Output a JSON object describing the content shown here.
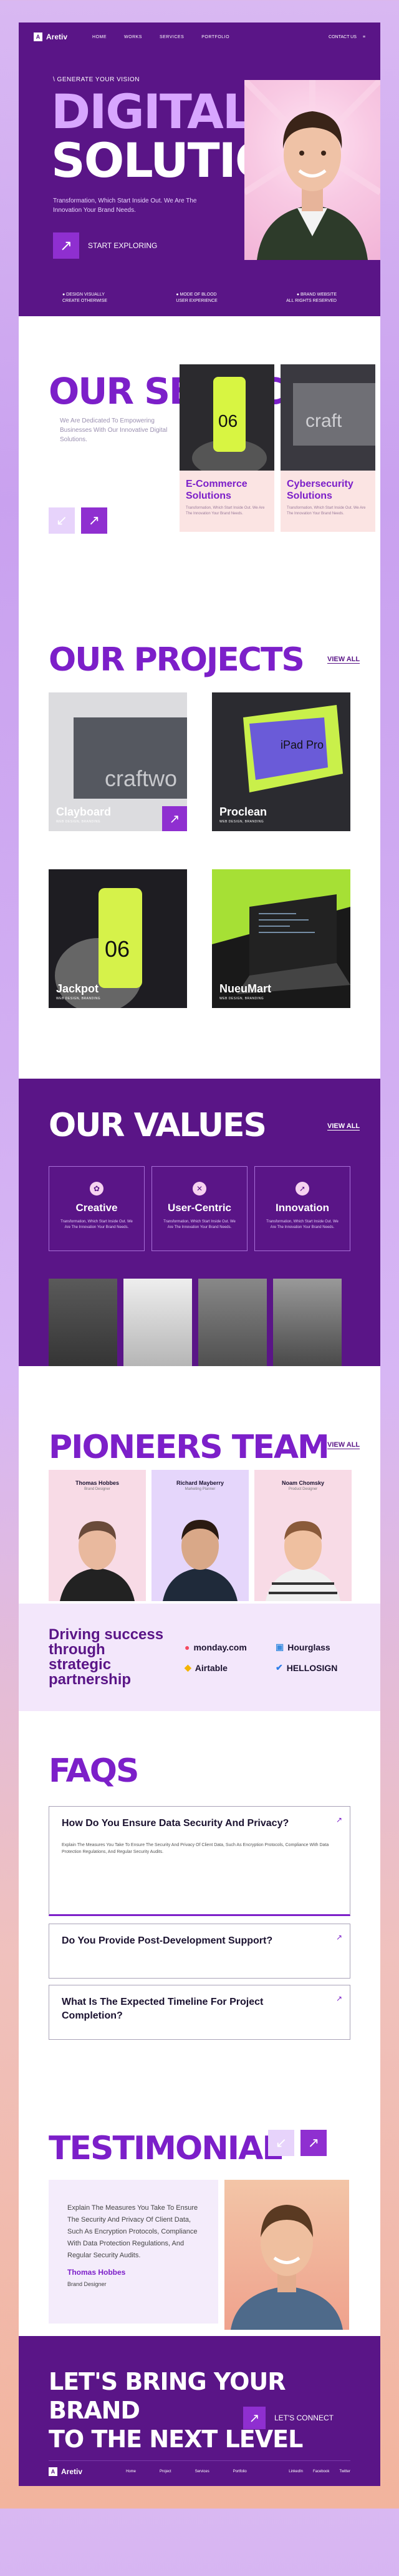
{
  "nav": {
    "brand": "Aretiv",
    "links": [
      "HOME",
      "WORKS",
      "SERVICES",
      "PORTFOLIO"
    ],
    "contact": "CONTACT US"
  },
  "hero": {
    "eyebrow": "\\ GENERATE YOUR VISION",
    "title_l1": "DIGITAL",
    "title_l2": "SOLUTIONS",
    "subtitle": "Transformation, Which Start Inside Out. We Are The Innovation Your Brand Needs.",
    "cta": "START EXPLORING",
    "foot_left": [
      "● DESIGN VISUALLY",
      "CREATE OTHERWISE"
    ],
    "foot_mid": [
      "● MODE OF BLOOD",
      "USER EXPERIENCE"
    ],
    "foot_right": [
      "● BRAND WEBSITE",
      "ALL RIGHTS RESERVED"
    ]
  },
  "services": {
    "title": "OUR SERVICES",
    "description": "We Are Dedicated To Empowering Businesses With Our Innovative Digital Solutions.",
    "cards": [
      {
        "title": "E-Commerce Solutions",
        "text": "Transformation, Which Start Inside Out. We Are The Innovation Your Brand Needs."
      },
      {
        "title": "Cybersecurity Solutions",
        "text": "Transformation, Which Start Inside Out. We Are The Innovation Your Brand Needs."
      }
    ]
  },
  "projects": {
    "title": "OUR PROJECTS",
    "view_all": "VIEW ALL",
    "items": [
      {
        "name": "Clayboard",
        "tags": "WEB DESIGN, BRANDING"
      },
      {
        "name": "Proclean",
        "tags": "WEB DESIGN, BRANDING"
      },
      {
        "name": "Jackpot",
        "tags": "WEB DESIGN, BRANDING"
      },
      {
        "name": "NueuMart",
        "tags": "WEB DESIGN, BRANDING"
      }
    ]
  },
  "values": {
    "title": "OUR VALUES",
    "view_all": "VIEW ALL",
    "items": [
      {
        "title": "Creative",
        "text": "Transformation, Which Start Inside Out. We Are The Innovation Your Brand Needs."
      },
      {
        "title": "User-Centric",
        "text": "Transformation, Which Start Inside Out. We Are The Innovation Your Brand Needs."
      },
      {
        "title": "Innovation",
        "text": "Transformation, Which Start Inside Out. We Are The Innovation Your Brand Needs."
      }
    ]
  },
  "team": {
    "title": "PIONEERS TEAM",
    "view_all": "VIEW ALL",
    "members": [
      {
        "name": "Thomas Hobbes",
        "role": "Brand Designer"
      },
      {
        "name": "Richard Mayberry",
        "role": "Marketing Planner"
      },
      {
        "name": "Noam Chomsky",
        "role": "Product Designer"
      }
    ]
  },
  "partner": {
    "title": "Driving success through strategic partnership",
    "logos": [
      "monday.com",
      "Hourglass",
      "Airtable",
      "HELLOSIGN"
    ]
  },
  "faqs": {
    "title": "FAQS",
    "items": [
      {
        "q": "How Do You Ensure Data Security And Privacy?",
        "a": "Explain The Measures You Take To Ensure The Security And Privacy Of Client Data, Such As Encryption Protocols, Compliance With Data Protection Regulations, And Regular Security Audits."
      },
      {
        "q": "Do You Provide Post-Development Support?",
        "a": ""
      },
      {
        "q": "What Is The Expected Timeline For Project Completion?",
        "a": ""
      }
    ]
  },
  "testimonial": {
    "title": "TESTIMONIAL",
    "quote": "Explain The Measures You Take To Ensure The Security And Privacy Of Client Data, Such As Encryption Protocols, Compliance With Data Protection Regulations, And Regular Security Audits.",
    "name": "Thomas Hobbes",
    "role": "Brand Designer"
  },
  "footer": {
    "line1": "LET'S BRING YOUR BRAND",
    "line2": "TO THE NEXT LEVEL",
    "cta": "LET'S CONNECT",
    "brand": "Aretiv",
    "links": [
      "Home",
      "Project",
      "Services",
      "Portfolio"
    ],
    "social": [
      "LinkedIn",
      "Facebook",
      "Twitter"
    ]
  },
  "colors": {
    "primary": "#5a1587",
    "accent": "#8f2fd0",
    "title_purple": "#7c1fc9"
  }
}
